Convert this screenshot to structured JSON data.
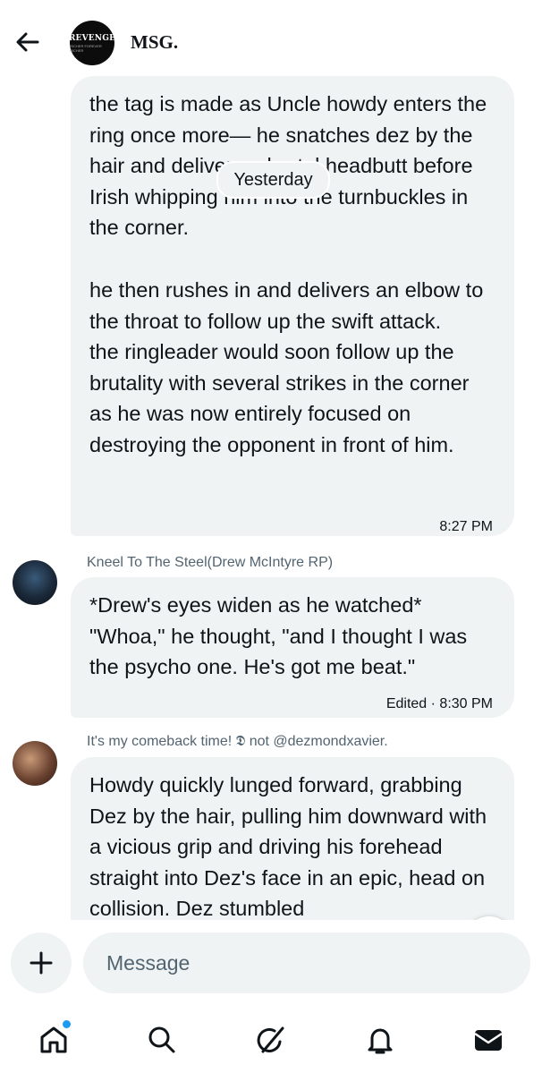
{
  "header": {
    "title": "MSG.",
    "group_avatar_text": "REVENGE",
    "group_avatar_subtext": "RICHER FOREVER RICHER"
  },
  "date_separator": "Yesterday",
  "messages": [
    {
      "paragraph1": "the tag is made as Uncle howdy enters the ring once more— he snatches dez by the hair and delivers a brutal headbutt before Irish whipping him into the turnbuckles in the corner.",
      "paragraph2": "he then rushes in and delivers an elbow to the throat to follow up the swift attack.\nthe ringleader would soon follow up the brutality with several strikes in the corner as he was now entirely focused on destroying the opponent in front of him.",
      "time": "8:27 PM"
    },
    {
      "sender": "Kneel To The Steel(Drew McIntyre RP)",
      "text": "*Drew's eyes widen as he watched*\n\"Whoa,\" he thought, \"and I thought I was the psycho one. He's got me beat.\"",
      "time": "Edited · 8:30 PM"
    },
    {
      "sender": "It's my comeback time! 𝕯 not @dezmondxavier.",
      "text": "Howdy quickly lunged forward, grabbing Dez by the hair, pulling him downward with a vicious grip and driving his forehead straight into Dez's face in an epic, head on collision. Dez stumbled"
    }
  ],
  "composer": {
    "placeholder": "Message"
  },
  "icons": {
    "back": "arrow-left-icon",
    "plus": "plus-icon",
    "scroll_down": "arrow-down-icon",
    "tabs": [
      "home-icon",
      "search-icon",
      "grok-icon",
      "bell-icon",
      "mail-icon"
    ]
  },
  "colors": {
    "bubble": "#eff3f4",
    "accent": "#1d9bf0",
    "secondary_text": "#536471"
  }
}
